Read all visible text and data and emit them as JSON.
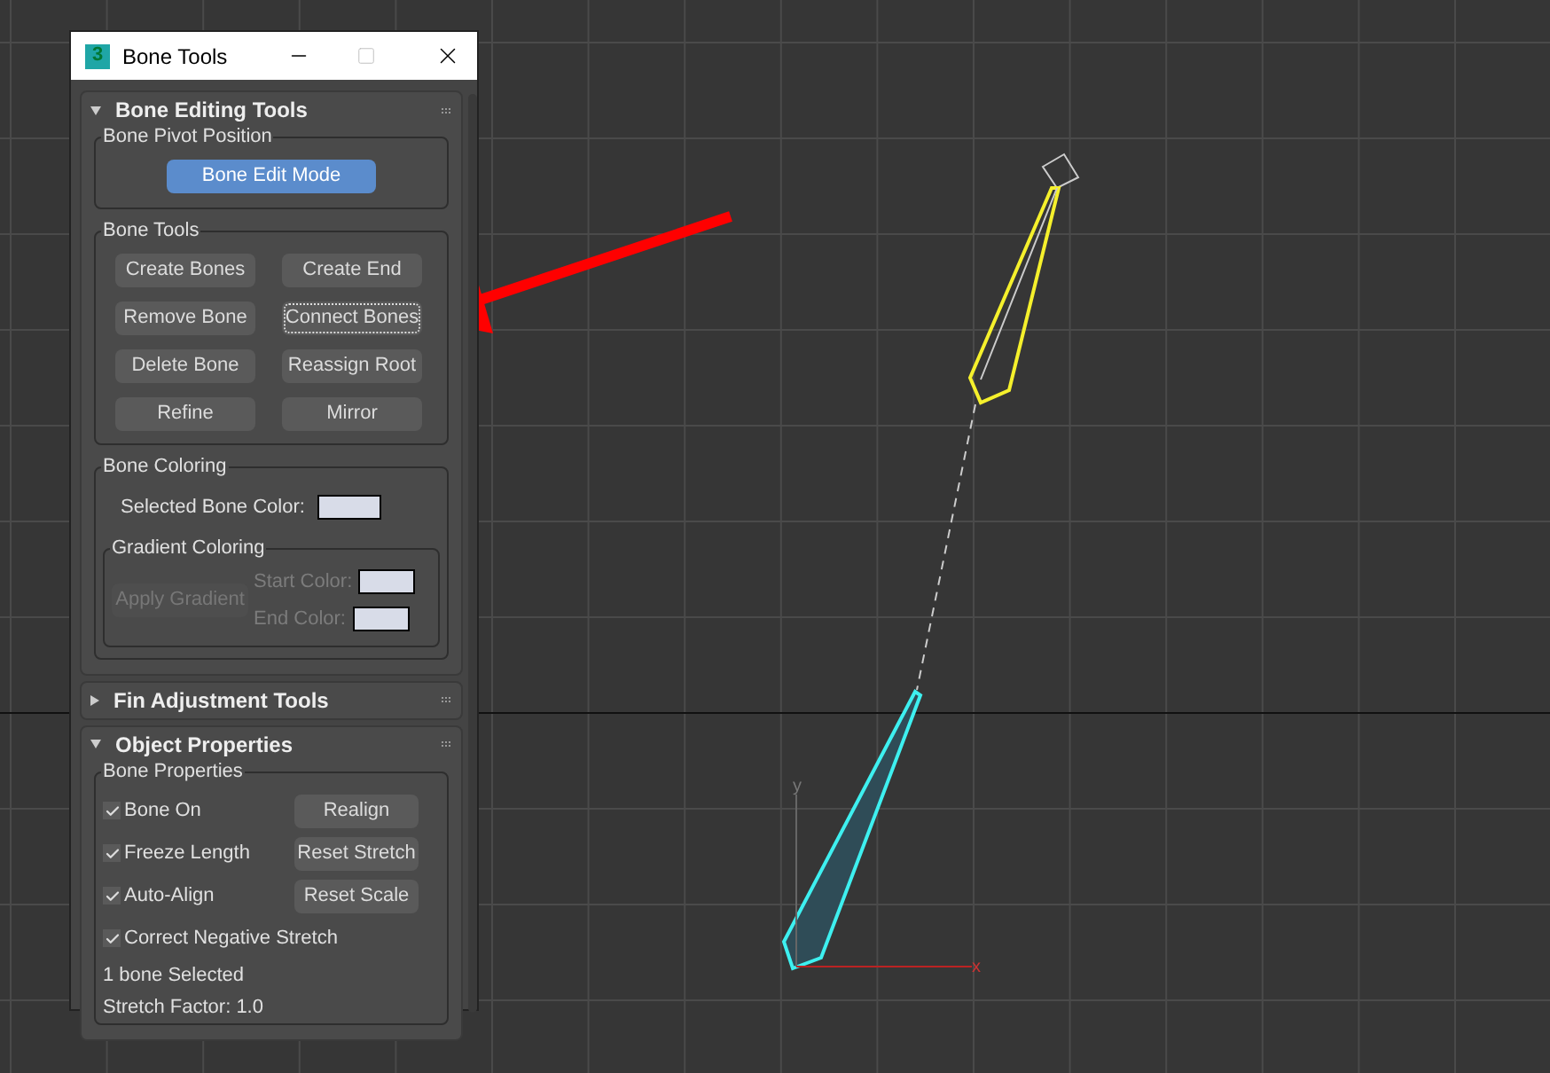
{
  "window": {
    "title": "Bone Tools",
    "icon_text": "3"
  },
  "viewport": {
    "axis_labels": [
      "y",
      "x"
    ]
  },
  "rollouts": [
    {
      "title": "Bone Editing Tools",
      "expanded": true,
      "groups": [
        {
          "kind": "buttons",
          "title": "Bone Pivot Position",
          "buttons": [
            {
              "label": "Bone Edit Mode",
              "selected": true,
              "focused": false
            }
          ]
        },
        {
          "kind": "buttons",
          "title": "Bone Tools",
          "buttons": [
            {
              "label": "Create Bones",
              "selected": false,
              "focused": false
            },
            {
              "label": "Create End",
              "selected": false,
              "focused": false
            },
            {
              "label": "Remove Bone",
              "selected": false,
              "focused": false
            },
            {
              "label": "Connect Bones",
              "selected": false,
              "focused": true
            },
            {
              "label": "Delete Bone",
              "selected": false,
              "focused": false
            },
            {
              "label": "Reassign Root",
              "selected": false,
              "focused": false
            },
            {
              "label": "Refine",
              "selected": false,
              "focused": false
            },
            {
              "label": "Mirror",
              "selected": false,
              "focused": false
            }
          ]
        },
        {
          "kind": "coloring",
          "title": "Bone Coloring",
          "swatch_label": "Selected Bone Color:",
          "color": "#d8dce8",
          "gradient": {
            "title": "Gradient Coloring",
            "button": {
              "label": "Apply Gradient",
              "disabled": true
            },
            "swatches": [
              {
                "label": "Start Color:",
                "color": "#d8dce8"
              },
              {
                "label": "End Color:",
                "color": "#d8dce8"
              }
            ]
          }
        }
      ]
    },
    {
      "title": "Fin Adjustment Tools",
      "expanded": false
    },
    {
      "title": "Object Properties",
      "expanded": true,
      "groups": [
        {
          "kind": "properties",
          "title": "Bone Properties",
          "rows": [
            {
              "label": "Bone On",
              "checked": true,
              "button": "Realign"
            },
            {
              "label": "Freeze Length",
              "checked": true,
              "button": "Reset Stretch"
            },
            {
              "label": "Auto-Align",
              "checked": true,
              "button": "Reset Scale"
            },
            {
              "label": "Correct Negative Stretch",
              "checked": true
            }
          ],
          "lines": [
            "1 bone Selected",
            "Stretch Factor: 1.0"
          ]
        }
      ]
    }
  ]
}
